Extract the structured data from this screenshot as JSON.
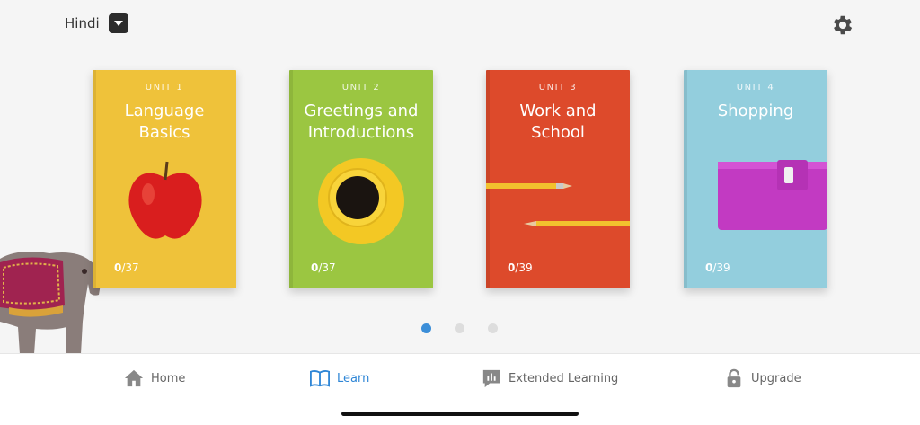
{
  "header": {
    "language": "Hindi"
  },
  "units": [
    {
      "unit_label": "UNIT 1",
      "title": "Language Basics",
      "progress_done": "0",
      "progress_total": "/37",
      "image": "apple",
      "color": "#efc23a"
    },
    {
      "unit_label": "UNIT 2",
      "title": "Greetings and Introductions",
      "progress_done": "0",
      "progress_total": "/37",
      "image": "coffee-cup",
      "color": "#9bc641"
    },
    {
      "unit_label": "UNIT 3",
      "title": "Work and School",
      "progress_done": "0",
      "progress_total": "/39",
      "image": "pencils",
      "color": "#dd4a2b"
    },
    {
      "unit_label": "UNIT 4",
      "title": "Shopping",
      "progress_done": "0",
      "progress_total": "/39",
      "image": "wallet",
      "color": "#93cedd"
    }
  ],
  "pagination": {
    "pages": 3,
    "current": 1
  },
  "nav": {
    "items": [
      {
        "label": "Home",
        "icon": "home-icon"
      },
      {
        "label": "Learn",
        "icon": "book-icon",
        "active": true
      },
      {
        "label": "Extended Learning",
        "icon": "chat-bars-icon"
      },
      {
        "label": "Upgrade",
        "icon": "lock-icon"
      }
    ]
  },
  "colors": {
    "accent": "#3b8ed8"
  }
}
